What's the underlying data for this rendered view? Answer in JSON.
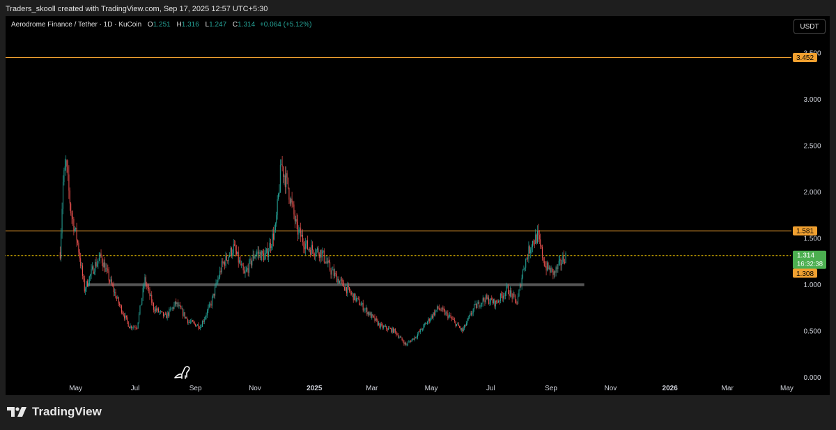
{
  "header": {
    "credit": "Traders_skooll created with TradingView.com, Sep 17, 2025 12:57 UTC+5:30"
  },
  "symbol": {
    "name": "Aerodrome Finance / Tether · 1D · KuCoin",
    "open_label": "O",
    "open": "1.251",
    "high_label": "H",
    "high": "1.316",
    "low_label": "L",
    "low": "1.247",
    "close_label": "C",
    "close": "1.314",
    "change": "+0.064 (+5.12%)"
  },
  "currency_button": "USDT",
  "footer": {
    "brand": "TradingView"
  },
  "colors": {
    "up": "#26a69a",
    "down": "#ef5350",
    "level_line": "#f0a030",
    "price_line": "#ffd000",
    "price_tag": "#4caf50",
    "zone": "#555555",
    "background": "#000000"
  },
  "icons": {
    "logo": "tradingview-logo-icon",
    "mascot": "dinosaur-icon"
  },
  "chart_data": {
    "type": "candlestick",
    "price_axis": {
      "ticks": [
        0,
        0.5,
        1.0,
        1.5,
        2.0,
        2.5,
        3.0,
        3.5
      ],
      "tick_labels": [
        "0.000",
        "0.500",
        "1.000",
        "1.500",
        "2.000",
        "2.500",
        "3.000",
        "3.500"
      ],
      "range": [
        -0.05,
        3.9
      ]
    },
    "time_axis": {
      "labels": [
        "May",
        "Jul",
        "Sep",
        "Nov",
        "2025",
        "Mar",
        "May",
        "Jul",
        "Sep",
        "Nov",
        "2026",
        "Mar",
        "May"
      ],
      "label_dates": [
        "2024-05-01",
        "2024-07-01",
        "2024-09-01",
        "2024-11-01",
        "2025-01-01",
        "2025-03-01",
        "2025-05-01",
        "2025-07-01",
        "2025-09-01",
        "2025-11-01",
        "2026-01-01",
        "2026-03-01",
        "2026-05-01"
      ],
      "bold": [
        "2025",
        "2026"
      ],
      "range": [
        "2024-02-19",
        "2026-06-14"
      ]
    },
    "horizontal_levels": [
      {
        "price": 3.452,
        "label": "3.452"
      },
      {
        "price": 1.581,
        "label": "1.581"
      }
    ],
    "current_price": {
      "price": 1.314,
      "label": "1.314",
      "countdown": "16:32:38"
    },
    "price_level_marker": {
      "price": 1.308,
      "label": "1.308"
    },
    "support_zone": {
      "price": 1.0,
      "from": "2024-05-13",
      "to": "2025-10-05"
    },
    "price_path": [
      [
        "2024-04-15",
        1.35
      ],
      [
        "2024-04-18",
        2.1
      ],
      [
        "2024-04-21",
        2.3
      ],
      [
        "2024-04-26",
        1.8
      ],
      [
        "2024-05-03",
        1.45
      ],
      [
        "2024-05-10",
        0.95
      ],
      [
        "2024-05-20",
        1.2
      ],
      [
        "2024-05-27",
        1.3
      ],
      [
        "2024-06-03",
        1.1
      ],
      [
        "2024-06-14",
        0.8
      ],
      [
        "2024-06-25",
        0.55
      ],
      [
        "2024-07-03",
        0.55
      ],
      [
        "2024-07-11",
        1.05
      ],
      [
        "2024-07-20",
        0.75
      ],
      [
        "2024-08-01",
        0.65
      ],
      [
        "2024-08-12",
        0.8
      ],
      [
        "2024-08-25",
        0.6
      ],
      [
        "2024-09-06",
        0.55
      ],
      [
        "2024-09-17",
        0.8
      ],
      [
        "2024-09-28",
        1.2
      ],
      [
        "2024-10-10",
        1.4
      ],
      [
        "2024-10-21",
        1.1
      ],
      [
        "2024-11-02",
        1.35
      ],
      [
        "2024-11-12",
        1.3
      ],
      [
        "2024-11-22",
        1.6
      ],
      [
        "2024-11-28",
        2.3
      ],
      [
        "2024-12-05",
        2.05
      ],
      [
        "2024-12-14",
        1.6
      ],
      [
        "2024-12-25",
        1.4
      ],
      [
        "2025-01-08",
        1.35
      ],
      [
        "2025-01-18",
        1.15
      ],
      [
        "2025-01-30",
        1.0
      ],
      [
        "2025-02-12",
        0.85
      ],
      [
        "2025-02-25",
        0.7
      ],
      [
        "2025-03-10",
        0.55
      ],
      [
        "2025-03-24",
        0.5
      ],
      [
        "2025-04-05",
        0.35
      ],
      [
        "2025-04-16",
        0.45
      ],
      [
        "2025-04-27",
        0.6
      ],
      [
        "2025-05-08",
        0.75
      ],
      [
        "2025-05-20",
        0.65
      ],
      [
        "2025-06-02",
        0.5
      ],
      [
        "2025-06-14",
        0.75
      ],
      [
        "2025-06-25",
        0.85
      ],
      [
        "2025-07-06",
        0.8
      ],
      [
        "2025-07-18",
        0.95
      ],
      [
        "2025-07-28",
        0.8
      ],
      [
        "2025-08-04",
        1.2
      ],
      [
        "2025-08-12",
        1.45
      ],
      [
        "2025-08-18",
        1.52
      ],
      [
        "2025-08-26",
        1.2
      ],
      [
        "2025-09-04",
        1.12
      ],
      [
        "2025-09-12",
        1.25
      ],
      [
        "2025-09-16",
        1.314
      ]
    ]
  }
}
